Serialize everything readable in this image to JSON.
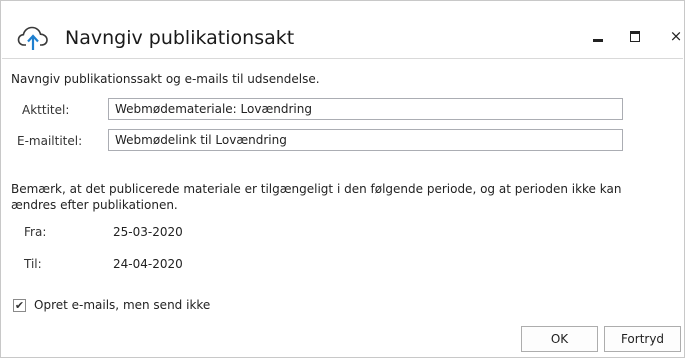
{
  "window": {
    "title": "Navngiv publikationsakt",
    "controls": {
      "minimize": "minimize",
      "maximize": "maximize",
      "close": "×"
    }
  },
  "intro": "Navngiv publikationssakt og e-mails til udsendelse.",
  "fields": {
    "akttitel_label": "Akttitel:",
    "akttitel_value": "Webmødemateriale: Lovændring",
    "emailtitel_label": "E-mailtitel:",
    "emailtitel_value": "Webmødelink til Lovændring"
  },
  "note": "Bemærk, at det publicerede materiale er tilgængeligt i den følgende periode, og at perioden ikke kan ændres efter publikationen.",
  "period": {
    "from_label": "Fra:",
    "from_value": "25-03-2020",
    "to_label": "Til:",
    "to_value": "24-04-2020"
  },
  "option": {
    "label": "Opret e-mails, men send ikke",
    "checked": true,
    "check_glyph": "✔"
  },
  "buttons": {
    "ok": "OK",
    "cancel": "Fortryd"
  },
  "colors": {
    "accent_icon": "#1e7fcf",
    "icon_outline": "#3a3a3a"
  }
}
